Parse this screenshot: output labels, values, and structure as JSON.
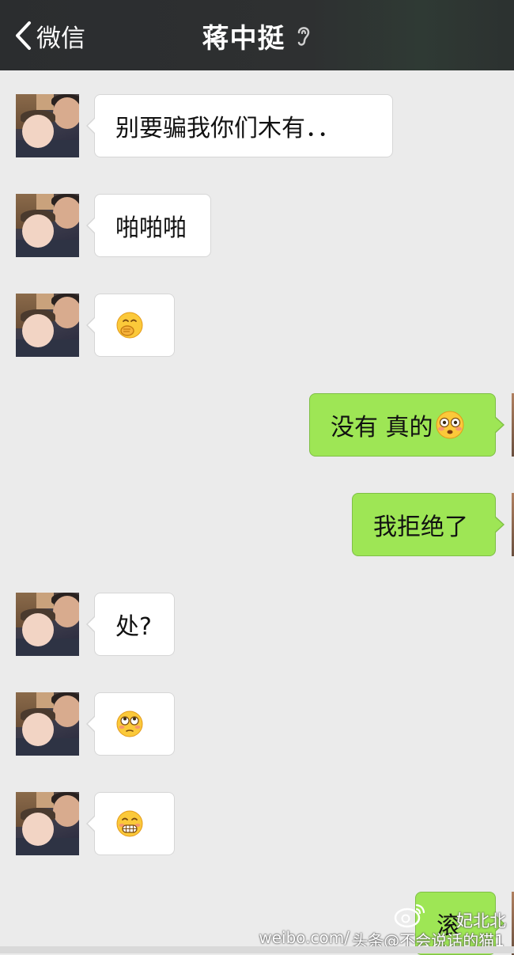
{
  "header": {
    "back_label": "微信",
    "title": "蒋中挺"
  },
  "messages": [
    {
      "side": "left",
      "text": "别要骗我你们木有．．"
    },
    {
      "side": "left",
      "text": "啪啪啪"
    },
    {
      "side": "left",
      "emoji": "cover-mouth-emoji"
    },
    {
      "side": "right",
      "text": "没有 真的",
      "emoji": "flushed-emoji"
    },
    {
      "side": "right",
      "text": "我拒绝了"
    },
    {
      "side": "left",
      "text": "处?"
    },
    {
      "side": "left",
      "emoji": "eye-roll-emoji"
    },
    {
      "side": "left",
      "emoji": "grimace-emoji"
    },
    {
      "side": "right",
      "text": "滚"
    }
  ],
  "watermarks": {
    "weibo_name": "妃北北",
    "site": "weibo.com/",
    "toutiao": "头条@不会说话的猫1"
  },
  "colors": {
    "header_bg": "#2e3031",
    "chat_bg": "#ebebeb",
    "sent_bubble": "#9ee655",
    "received_bubble": "#ffffff"
  }
}
